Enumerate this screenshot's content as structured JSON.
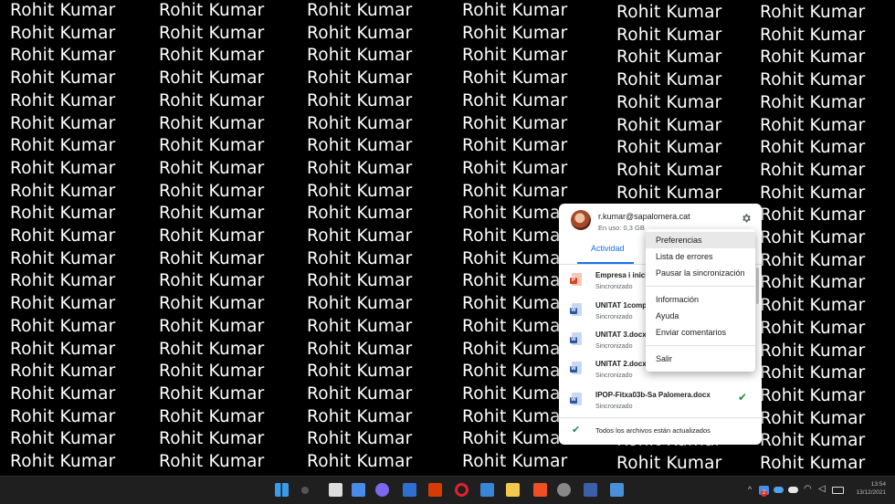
{
  "wallpaper": {
    "text": "Rohit Kumar"
  },
  "drive": {
    "account": {
      "email": "r.kumar@sapalomera.cat",
      "usage": "En uso: 0,3 GB"
    },
    "tab_activity": "Actividad",
    "files": [
      {
        "name": "Empresa i inici",
        "status": "Sincronizado",
        "type": "ppt",
        "icon": "powerpoint-file-icon"
      },
      {
        "name": "UNITAT 1comp",
        "status": "Sincronizado",
        "type": "doc",
        "icon": "word-file-icon"
      },
      {
        "name": "UNITAT 3.docx",
        "status": "Sincronizado",
        "type": "doc",
        "icon": "word-file-icon"
      },
      {
        "name": "UNITAT 2.docx",
        "status": "Sincronizado",
        "type": "doc",
        "icon": "word-file-icon"
      },
      {
        "name": "IPOP-Fitxa03b-Sa Palomera.docx",
        "status": "Sincronizado",
        "type": "doc",
        "icon": "word-file-icon"
      }
    ],
    "footer": "Todos los archivos están actualizados"
  },
  "menu": {
    "items": [
      {
        "label": "Preferencias"
      },
      {
        "label": "Lista de errores"
      },
      {
        "label": "Pausar la sincronización"
      },
      {
        "label": "Información"
      },
      {
        "label": "Ayuda"
      },
      {
        "label": "Enviar comentarios"
      },
      {
        "label": "Salir"
      }
    ]
  },
  "taskbar": {
    "icons": [
      "windows-start-icon",
      "search-icon",
      "task-view-icon",
      "widgets-icon",
      "teams-chat-icon",
      "store-icon",
      "office-icon",
      "opera-icon",
      "mail-icon",
      "file-explorer-icon",
      "brave-icon",
      "settings-icon",
      "virtualbox-icon",
      "snipping-tool-icon"
    ],
    "tray_badge": "2",
    "clock_time": "13:54",
    "clock_date": "13/12/2021"
  },
  "colors": {
    "accent": "#1a73e8",
    "check": "#1e8e3e",
    "taskbar": "#1f1f1f",
    "wallpaper": "#000000"
  }
}
